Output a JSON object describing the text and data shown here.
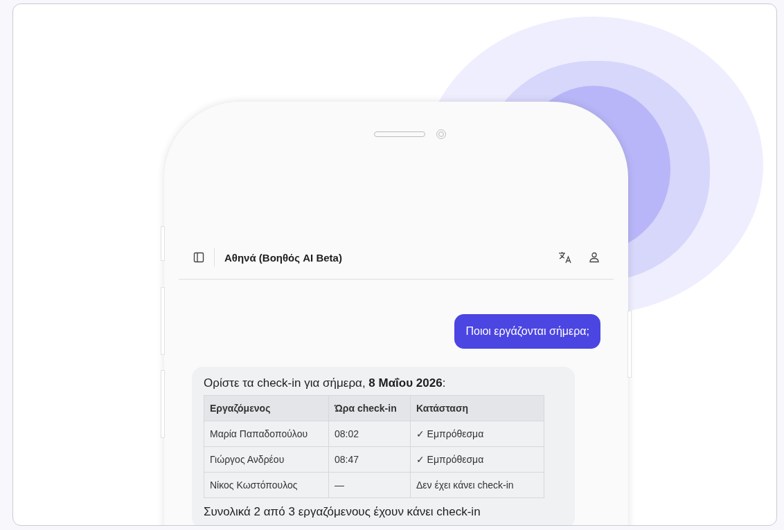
{
  "header": {
    "title": "Αθηνά (Βοηθός AI Beta)"
  },
  "messages": [
    {
      "kind": "user",
      "text": "Ποιοι εργάζονται σήμερα;"
    },
    {
      "kind": "assistant",
      "intro": "Ορίστε τα check-in για σήμερα, **8 Μαΐου 2026**:",
      "table": {
        "columns": [
          "Εργαζόμενος",
          "Ώρα check-in",
          "Κατάσταση"
        ],
        "rows": [
          [
            "Μαρία Παπαδοπούλου",
            "08:02",
            "✓ Εμπρόθεσμα"
          ],
          [
            "Γιώργος Ανδρέου",
            "08:47",
            "✓ Εμπρόθεσμα"
          ],
          [
            "Νίκος Κωστόπουλος",
            "—",
            "Δεν έχει κάνει check-in"
          ]
        ]
      },
      "summary": "Συνολικά 2 από 3 εργαζόμενους έχουν κάνει check-in"
    }
  ]
}
